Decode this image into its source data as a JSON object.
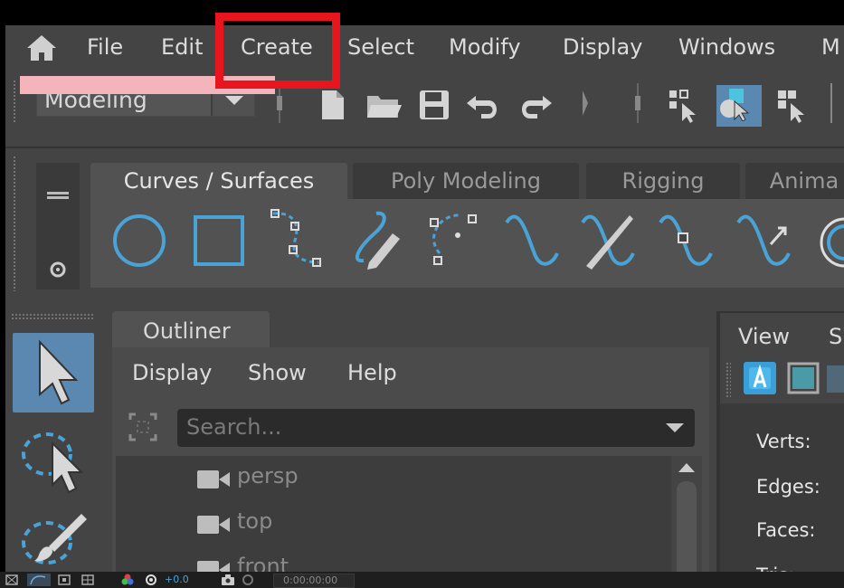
{
  "menubar": {
    "items": [
      "File",
      "Edit",
      "Create",
      "Select",
      "Modify",
      "Display",
      "Windows",
      "M"
    ]
  },
  "toolbar": {
    "mode": "Modeling"
  },
  "shelf": {
    "tabs": [
      "Curves / Surfaces",
      "Poly Modeling",
      "Rigging",
      "Anima"
    ],
    "active_tab": "Curves / Surfaces"
  },
  "outliner": {
    "title": "Outliner",
    "menu": [
      "Display",
      "Show",
      "Help"
    ],
    "search_placeholder": "Search...",
    "items": [
      "persp",
      "top",
      "front"
    ]
  },
  "right_panel": {
    "tabs": [
      "View",
      "Sh"
    ],
    "stats": [
      "Verts:",
      "Edges:",
      "Faces:",
      "Tris:"
    ]
  },
  "statusbar": {
    "value": "+0.0",
    "time": "0:00:00:00"
  },
  "colors": {
    "highlight": "#e8141e",
    "accent": "#4aa3d6",
    "active_tool": "#5a88b0",
    "marker": "#f4b4bc"
  }
}
